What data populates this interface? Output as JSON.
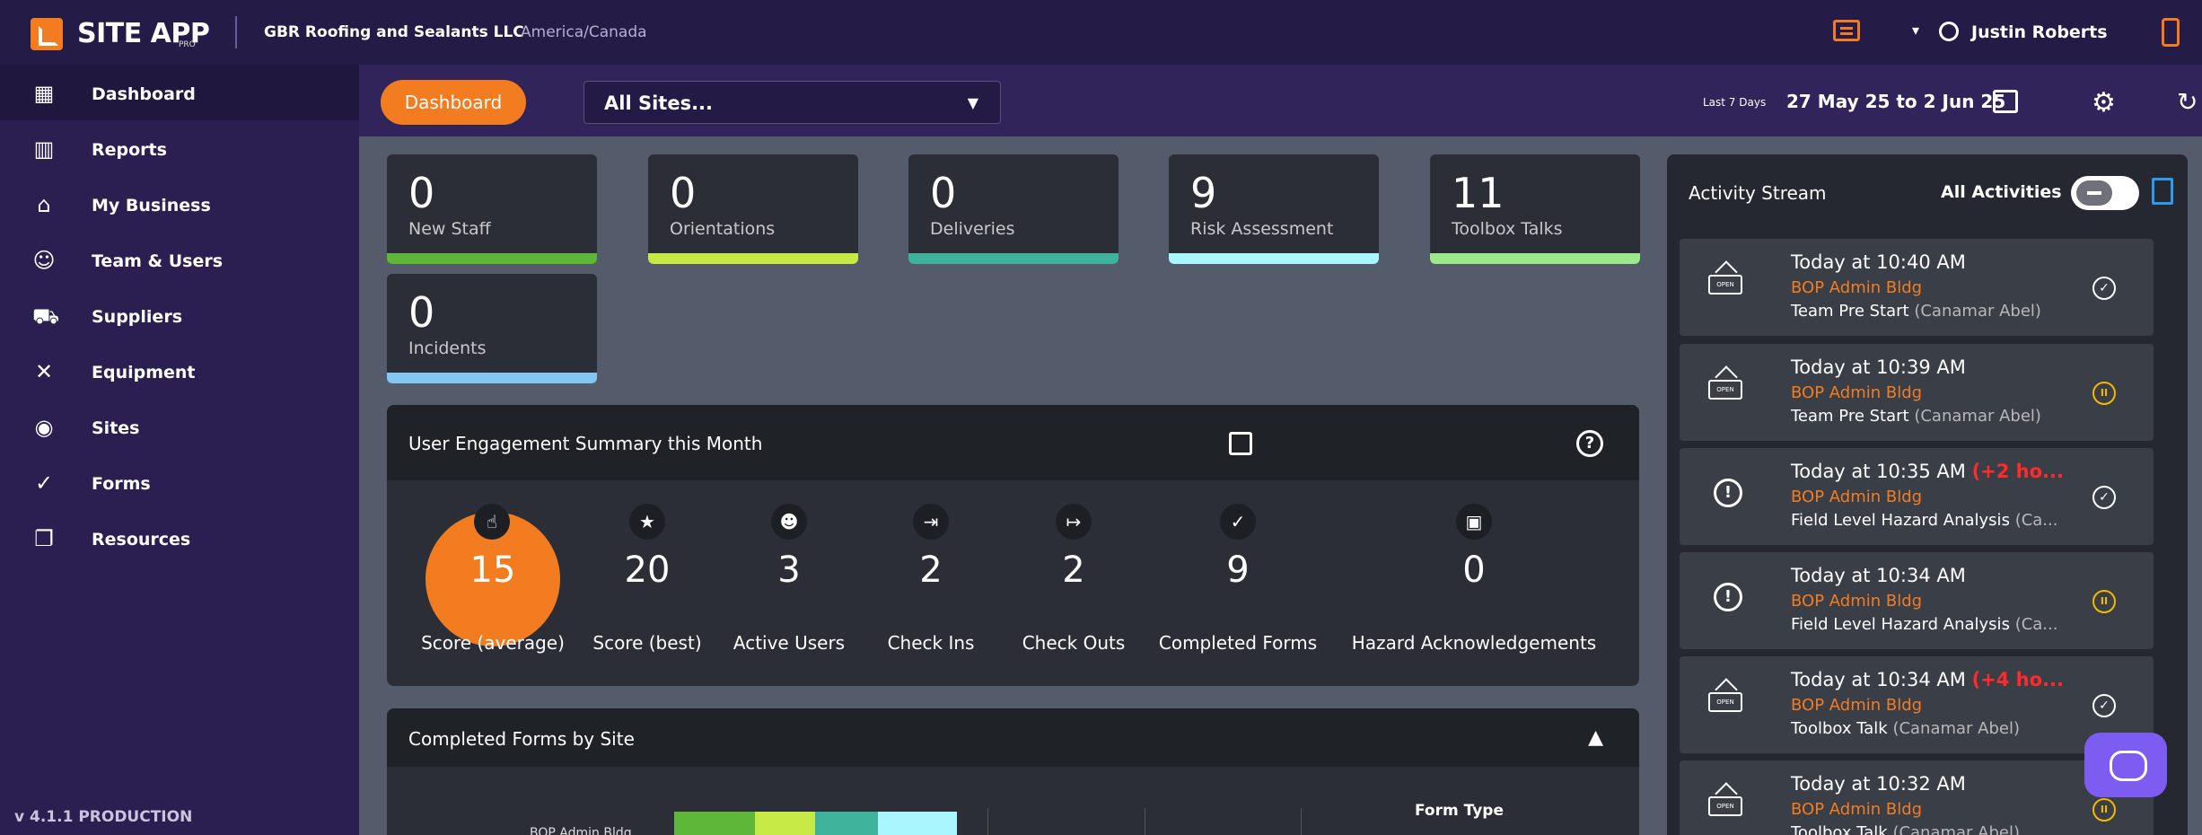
{
  "brand": {
    "name": "SITE APP",
    "sub": "PRO",
    "accent": "#f47c20"
  },
  "header": {
    "company": "GBR Roofing and Sealants LLC",
    "region": "America/Canada",
    "user": "Justin Roberts"
  },
  "sidebar": {
    "items": [
      {
        "label": "Dashboard",
        "icon": "dashboard-grid-icon"
      },
      {
        "label": "Reports",
        "icon": "bar-chart-icon"
      },
      {
        "label": "My Business",
        "icon": "store-icon"
      },
      {
        "label": "Team & Users",
        "icon": "team-icon"
      },
      {
        "label": "Suppliers",
        "icon": "truck-icon"
      },
      {
        "label": "Equipment",
        "icon": "tools-icon"
      },
      {
        "label": "Sites",
        "icon": "location-icon"
      },
      {
        "label": "Forms",
        "icon": "check-circle-icon"
      },
      {
        "label": "Resources",
        "icon": "copy-icon"
      }
    ],
    "version": "v 4.1.1 PRODUCTION"
  },
  "filters": {
    "dashboard_button": "Dashboard",
    "site_select": "All Sites...",
    "range_label": "Last 7 Days",
    "range_text": "27 May 25 to 2 Jun 25"
  },
  "stats": [
    {
      "value": "0",
      "label": "New Staff",
      "color": "#5fb73a"
    },
    {
      "value": "0",
      "label": "Orientations",
      "color": "#c5e945"
    },
    {
      "value": "0",
      "label": "Deliveries",
      "color": "#3fb29b"
    },
    {
      "value": "9",
      "label": "Risk Assessment",
      "color": "#a9f6ff"
    },
    {
      "value": "11",
      "label": "Toolbox Talks",
      "color": "#9ee88c"
    },
    {
      "value": "0",
      "label": "Incidents",
      "color": "#84c6f2"
    }
  ],
  "engagement": {
    "title": "User Engagement Summary this Month",
    "metrics": [
      {
        "value": "15",
        "label": "Score (average)",
        "icon": "touch-icon"
      },
      {
        "value": "20",
        "label": "Score (best)",
        "icon": "star-icon"
      },
      {
        "value": "3",
        "label": "Active Users",
        "icon": "users-icon"
      },
      {
        "value": "2",
        "label": "Check Ins",
        "icon": "login-icon"
      },
      {
        "value": "2",
        "label": "Check Outs",
        "icon": "logout-icon"
      },
      {
        "value": "9",
        "label": "Completed Forms",
        "icon": "check-circle-icon"
      },
      {
        "value": "0",
        "label": "Hazard Acknowledgements",
        "icon": "clipboard-icon"
      }
    ]
  },
  "completed_forms": {
    "title": "Completed Forms by Site",
    "legend_title": "Form Type",
    "site_label": "BOP Admin Bldg",
    "bar_colors": [
      "#5fb73a",
      "#c5e945",
      "#3fb29b",
      "#a9f6ff"
    ]
  },
  "activity": {
    "title": "Activity Stream",
    "filter_label": "All Activities",
    "items": [
      {
        "time": "Today at 10:40 AM",
        "extra": "",
        "site": "BOP Admin Bldg",
        "form": "Team Pre Start",
        "by": "(Canamar Abel)",
        "kind": "open",
        "status": "complete"
      },
      {
        "time": "Today at 10:39 AM",
        "extra": "",
        "site": "BOP Admin Bldg",
        "form": "Team Pre Start",
        "by": "(Canamar Abel)",
        "kind": "open",
        "status": "pending"
      },
      {
        "time": "Today at 10:35 AM",
        "extra": "(+2 ho...",
        "site": "BOP Admin Bldg",
        "form": "Field Level Hazard Analysis",
        "by": "(Ca...",
        "kind": "hazard",
        "status": "complete"
      },
      {
        "time": "Today at 10:34 AM",
        "extra": "",
        "site": "BOP Admin Bldg",
        "form": "Field Level Hazard Analysis",
        "by": "(Ca...",
        "kind": "hazard",
        "status": "pending"
      },
      {
        "time": "Today at 10:34 AM",
        "extra": "(+4 ho...",
        "site": "BOP Admin Bldg",
        "form": "Toolbox Talk",
        "by": "(Canamar Abel)",
        "kind": "open",
        "status": "complete"
      },
      {
        "time": "Today at 10:32 AM",
        "extra": "",
        "site": "BOP Admin Bldg",
        "form": "Toolbox Talk",
        "by": "(Canamar Abel)",
        "kind": "open",
        "status": "pending"
      }
    ]
  }
}
